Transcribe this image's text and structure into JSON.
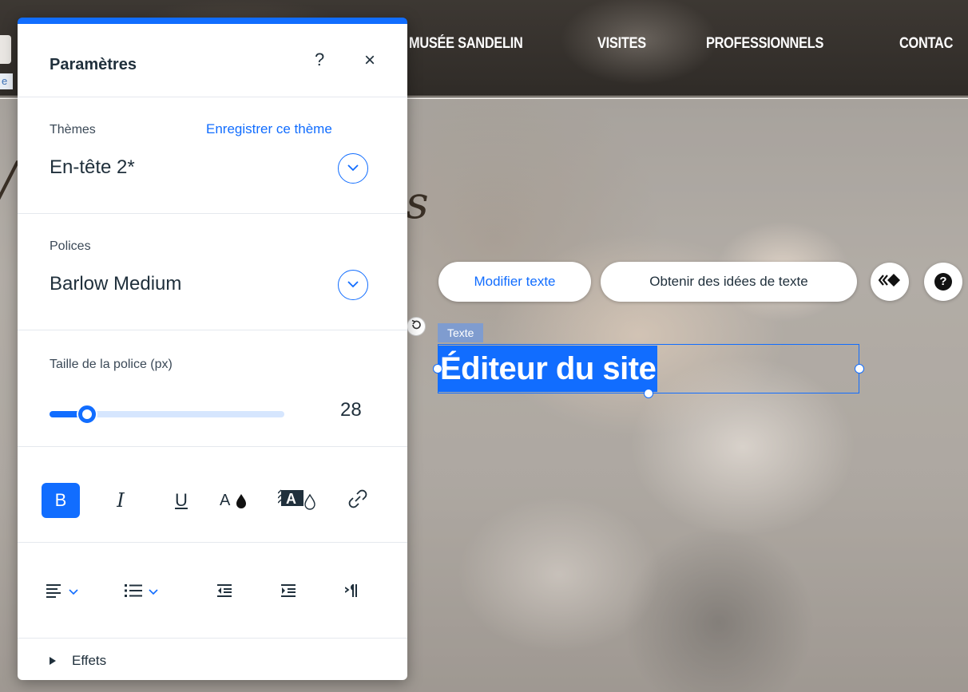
{
  "site": {
    "nav": [
      "MUSÉE SANDELIN",
      "VISITES",
      "PROFESSIONNELS",
      "CONTAC"
    ],
    "left_fragment": "e",
    "decor_letter": "s"
  },
  "floating_toolbar": {
    "edit_label": "Modifier texte",
    "ideas_label": "Obtenir des idées de texte",
    "animation_icon": "animation-icon",
    "help_icon": "help-icon",
    "help_glyph": "?"
  },
  "selected_element": {
    "tag": "Texte",
    "text": "Éditeur du site"
  },
  "panel": {
    "title": "Paramètres",
    "help_glyph": "?",
    "close_glyph": "×",
    "themes": {
      "label": "Thèmes",
      "save_link": "Enregistrer ce thème",
      "value": "En-tête 2*"
    },
    "fonts": {
      "label": "Polices",
      "value": "Barlow Medium"
    },
    "font_size": {
      "label": "Taille de la police (px)",
      "value": "28",
      "slider_fraction": 0.16
    },
    "format": {
      "bold": "B",
      "italic": "I",
      "underline": "U",
      "icons": [
        "text-color-icon",
        "text-highlight-icon",
        "link-icon"
      ]
    },
    "alignment": {
      "icons": [
        "align-left-icon",
        "bullet-list-icon",
        "decrease-indent-icon",
        "increase-indent-icon",
        "text-direction-icon"
      ]
    },
    "effects": {
      "label": "Effets"
    }
  },
  "colors": {
    "accent": "#116dff",
    "text": "#20303c"
  }
}
